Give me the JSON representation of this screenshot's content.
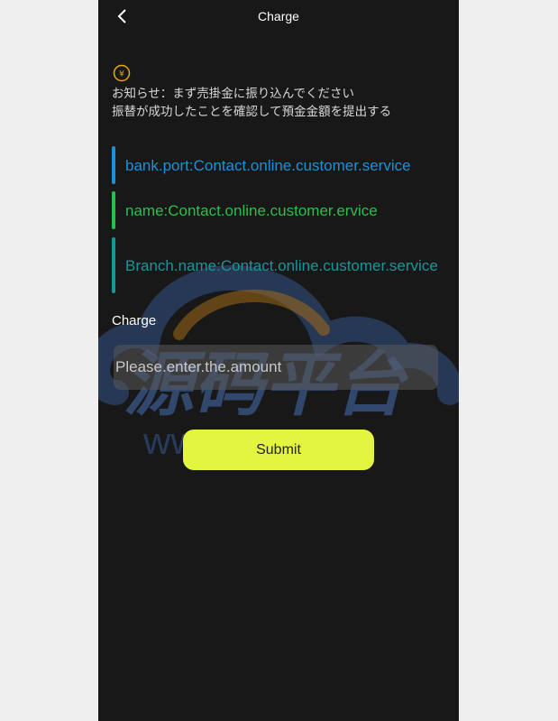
{
  "header": {
    "title": "Charge"
  },
  "notice": {
    "icon": "yen-icon",
    "line1": "お知らせ：まず売掛金に振り込んでください",
    "line2": "振替が成功したことを確認して預金金額を提出する"
  },
  "info": {
    "items": [
      {
        "text": "bank.port:Contact.online.customer.service",
        "color": "#1e90d6"
      },
      {
        "text": "name:Contact.online.customer.ervice",
        "color": "#2bbf4e"
      },
      {
        "text": "Branch.name:Contact.online.customer.service",
        "color": "#17979a"
      }
    ]
  },
  "form": {
    "label": "Charge",
    "placeholder": "Please.enter.the.amount",
    "submit_label": "Submit"
  },
  "watermark": {
    "text": "源码平台",
    "url": "www.ympt.cc"
  },
  "colors": {
    "background": "#181818",
    "accent": "#e3f53e",
    "notice_icon": "#e6a817"
  }
}
